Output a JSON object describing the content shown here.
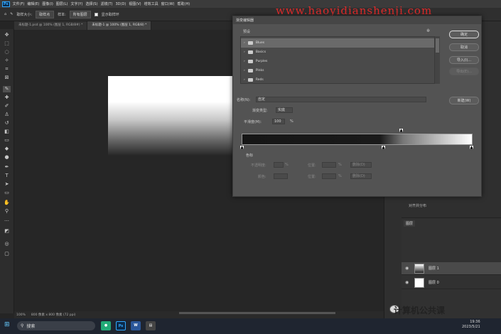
{
  "menubar": {
    "app_badge": "Ps",
    "items": [
      "文件(F)",
      "编辑(E)",
      "图像(I)",
      "图层(L)",
      "文字(Y)",
      "选择(S)",
      "滤镜(T)",
      "3D(D)",
      "视图(V)",
      "增效工具",
      "窗口(W)",
      "帮助(H)"
    ]
  },
  "optionsbar": {
    "sample_size_label": "取样大小:",
    "sample_size_value": "取样点",
    "sample_label": "样本:",
    "sample_value": "所有图层",
    "show_ring_label": "显示取样环"
  },
  "tabs": [
    {
      "label": "未标题-1.psd @ 100% (图层 1, RGB/8#) *"
    },
    {
      "label": "未标题-1 @ 100% (图层 1, RGB/8) *"
    }
  ],
  "statusbar": {
    "zoom": "100%",
    "info": "800 像素 x 800 像素 (72 ppi)"
  },
  "layers": {
    "panel_tab": "图层",
    "props_label": "对齐并分布",
    "rows": [
      {
        "name": "图层 1"
      },
      {
        "name": "图层 0"
      }
    ]
  },
  "taskbar": {
    "search_placeholder": "搜索",
    "time": "19:36",
    "date": "2023/5/21",
    "apps": [
      "Ps",
      "W"
    ]
  },
  "dialog": {
    "title": "渐变编辑器",
    "presets_label": "预设",
    "preset_items": [
      "Blues",
      "Basics",
      "Purples",
      "Pinks",
      "Reds"
    ],
    "ok": "确定",
    "cancel": "取消",
    "import": "导入(I)...",
    "export": "导出(E)...",
    "name_label": "名称(N):",
    "name_value": "自定",
    "new_button": "新建(W)",
    "gradient_type_label": "渐变类型:",
    "gradient_type_value": "实底",
    "smoothness_label": "平滑度(M):",
    "smoothness_value": "100",
    "smoothness_unit": "%",
    "color_stops_label": "色标",
    "opacity_label": "不透明度:",
    "location_label": "位置:",
    "delete_label": "删除(D)",
    "color_label": "颜色:",
    "pct": "%"
  },
  "watermark": "www.haoyidianshenji.com",
  "logo_text": "计算机公共课",
  "colors": {
    "watermark": "#e12b2b",
    "accent": "#31a8ff"
  }
}
